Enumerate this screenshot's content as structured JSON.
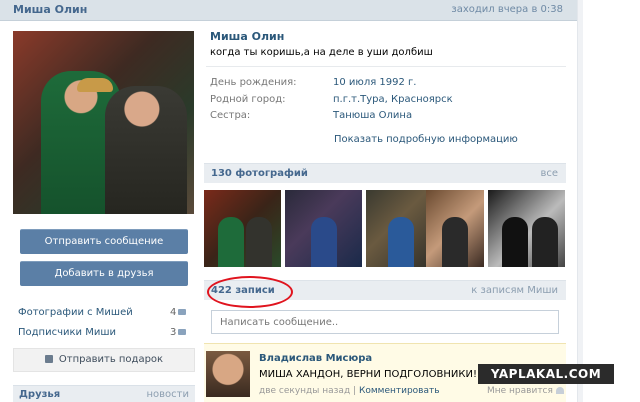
{
  "topbar": {
    "name": "Миша Олин",
    "last_seen": "заходил вчера в 0:38"
  },
  "left": {
    "send_message": "Отправить сообщение",
    "add_friend": "Добавить в друзья",
    "photos_with_label": "Фотографии с Мишей",
    "photos_with_count": "4",
    "subscribers_label": "Подписчики Миши",
    "subscribers_count": "3",
    "gift_label": "Отправить подарок",
    "friends_title": "Друзья",
    "friends_new": "новости"
  },
  "profile": {
    "name": "Миша Олин",
    "status": "когда ты коришь,а на деле в уши долбиш",
    "info": [
      {
        "label": "День рождения:",
        "value": "10 июля 1992 г."
      },
      {
        "label": "Родной город:",
        "value": "п.г.т.Тура, Красноярск"
      },
      {
        "label": "Сестра:",
        "value": "Танюша Олина"
      }
    ],
    "more_info": "Показать подробную информацию"
  },
  "photos": {
    "title": "130 фотографий",
    "all_link": "все"
  },
  "posts": {
    "title": "422 записи",
    "to_posts": "к записям Миши",
    "input_placeholder": "Написать сообщение..",
    "post": {
      "author": "Владислав Мисюра",
      "text": "МИША ХАНДОН, ВЕРНИ ПОДГОЛОВНИКИ!",
      "time": "две секунды назад",
      "separator": "|",
      "comment": "Комментировать",
      "like": "Мне нравится"
    }
  },
  "watermark": "YAPLAKAL.COM"
}
